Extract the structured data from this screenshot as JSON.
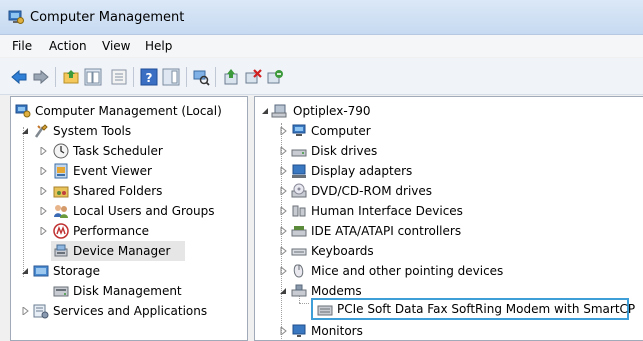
{
  "window": {
    "title": "Computer Management"
  },
  "menu": [
    "File",
    "Action",
    "View",
    "Help"
  ],
  "toolbar_icons": [
    "back-arrow-icon",
    "forward-arrow-icon",
    "up-folder-icon",
    "show-hide-tree-icon",
    "properties-icon",
    "help-icon",
    "action-pane-icon",
    "scan-hardware-icon",
    "update-driver-icon",
    "uninstall-icon",
    "disable-device-icon"
  ],
  "left_tree": {
    "root": "Computer Management (Local)",
    "items": [
      "System Tools",
      "Task Scheduler",
      "Event Viewer",
      "Shared Folders",
      "Local Users and Groups",
      "Performance",
      "Device Manager",
      "Storage",
      "Disk Management",
      "Services and Applications"
    ]
  },
  "right_tree": {
    "root": "Optiplex-790",
    "items": [
      "Computer",
      "Disk drives",
      "Display adapters",
      "DVD/CD-ROM drives",
      "Human Interface Devices",
      "IDE ATA/ATAPI controllers",
      "Keyboards",
      "Mice and other pointing devices",
      "Modems",
      "PCIe Soft Data Fax SoftRing Modem with SmartCP",
      "Monitors"
    ]
  },
  "colors": {
    "selection_border": "#3e9ed8",
    "tree_selection": "#e6e6e6"
  }
}
